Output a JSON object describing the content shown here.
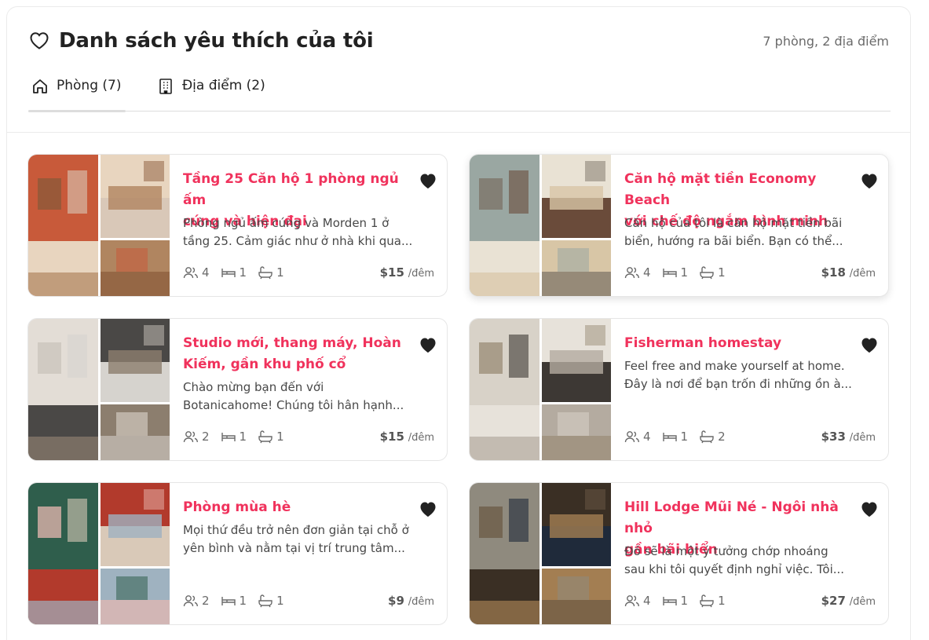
{
  "header": {
    "title": "Danh sách yêu thích của tôi",
    "summary": "7 phòng, 2 địa điểm"
  },
  "tabs": [
    {
      "label": "Phòng (7)",
      "icon": "home-icon",
      "active": true
    },
    {
      "label": "Địa điểm (2)",
      "icon": "building-icon",
      "active": false
    }
  ],
  "colors": {
    "accent": "#f0325c",
    "text": "#222222",
    "muted": "#6a6a6a"
  },
  "listings": [
    {
      "title_1": "Tầng 25 Căn hộ 1 phòng ngủ ấm",
      "title_2": "cúng và hiện đại",
      "desc_1": "Phòng ngủ ấm cúng và Morden 1 ở",
      "desc_2": "tầng 25. Cảm giác như ở nhà khi qua...",
      "guests": "4",
      "beds": "1",
      "baths": "1",
      "price": "$15",
      "per": "/đêm"
    },
    {
      "title_1": "Căn hộ mặt tiền Economy Beach",
      "title_2": "với chế độ ngắm bình minh",
      "desc_1": "Căn hộ của tôi là căn hộ mặt tiền bãi",
      "desc_2": "biển, hướng ra bãi biển. Bạn có thể...",
      "guests": "4",
      "beds": "1",
      "baths": "1",
      "price": "$18",
      "per": "/đêm"
    },
    {
      "title_1": "Studio mới, thang máy, Hoàn",
      "title_2": "Kiếm, gần khu phố cổ",
      "desc_1": "Chào mừng bạn đến với",
      "desc_2": "Botanicahome! Chúng tôi hân hạnh...",
      "guests": "2",
      "beds": "1",
      "baths": "1",
      "price": "$15",
      "per": "/đêm"
    },
    {
      "title_1": "Fisherman homestay",
      "title_2": "",
      "desc_1": "Feel free and make yourself at home.",
      "desc_2": "Đây là nơi để bạn trốn đi những ồn à...",
      "guests": "4",
      "beds": "1",
      "baths": "2",
      "price": "$33",
      "per": "/đêm"
    },
    {
      "title_1": "Phòng mùa hè",
      "title_2": "",
      "desc_1": "Mọi thứ đều trở nên đơn giản tại chỗ ở",
      "desc_2": "yên bình và nằm tại vị trí trung tâm...",
      "guests": "2",
      "beds": "1",
      "baths": "1",
      "price": "$9",
      "per": "/đêm"
    },
    {
      "title_1": "Hill Lodge Mũi Né - Ngôi nhà nhỏ",
      "title_2": "gần bãi biển",
      "desc_1": "Đó sẽ là một ý tưởng chớp nhoáng",
      "desc_2": "sau khi tôi quyết định nghỉ việc. Tôi...",
      "guests": "4",
      "beds": "1",
      "baths": "1",
      "price": "$27",
      "per": "/đêm"
    }
  ]
}
